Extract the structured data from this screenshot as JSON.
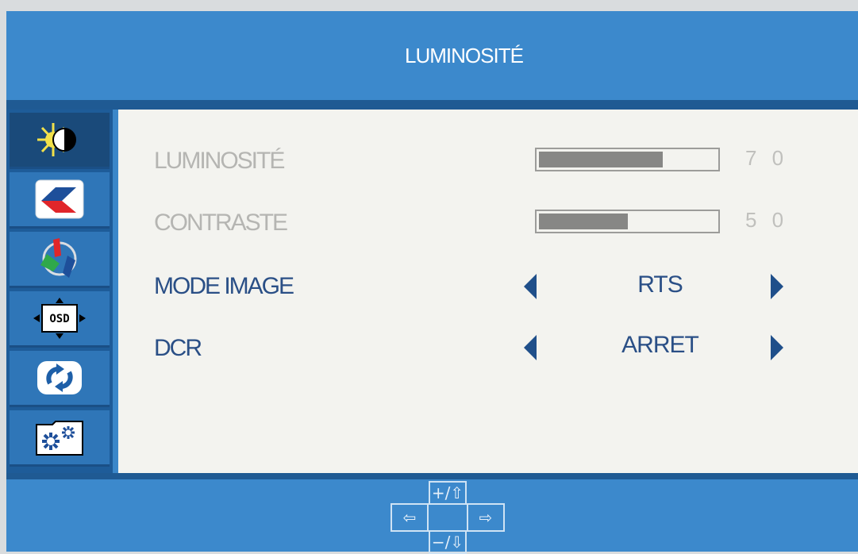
{
  "menu_title": "LUMINOSITÉ",
  "sidebar": {
    "items": [
      {
        "icon": "brightness-icon"
      },
      {
        "icon": "image-icon"
      },
      {
        "icon": "color-icon"
      },
      {
        "icon": "osd-settings-icon"
      },
      {
        "icon": "reset-icon"
      },
      {
        "icon": "extra-settings-icon"
      }
    ],
    "osd_icon_text": "OSD"
  },
  "settings": {
    "brightness": {
      "label": "LUMINOSITÉ",
      "value": "7 0",
      "level_percent": 70
    },
    "contrast": {
      "label": "CONTRASTE",
      "value": "5 0",
      "level_percent": 50
    },
    "picture_mode": {
      "label": "MODE IMAGE",
      "value": "RTS"
    },
    "dcr": {
      "label": "DCR",
      "value": "ARRET"
    }
  },
  "keys": {
    "up": "+/⇧",
    "left": "⇦",
    "right": "⇨",
    "down": "−/⇩"
  },
  "colors": {
    "frame": "#3c89cc",
    "panel": "#f3f3ef",
    "active_text": "#2a4f86",
    "dim_text": "#b5b5b2"
  }
}
